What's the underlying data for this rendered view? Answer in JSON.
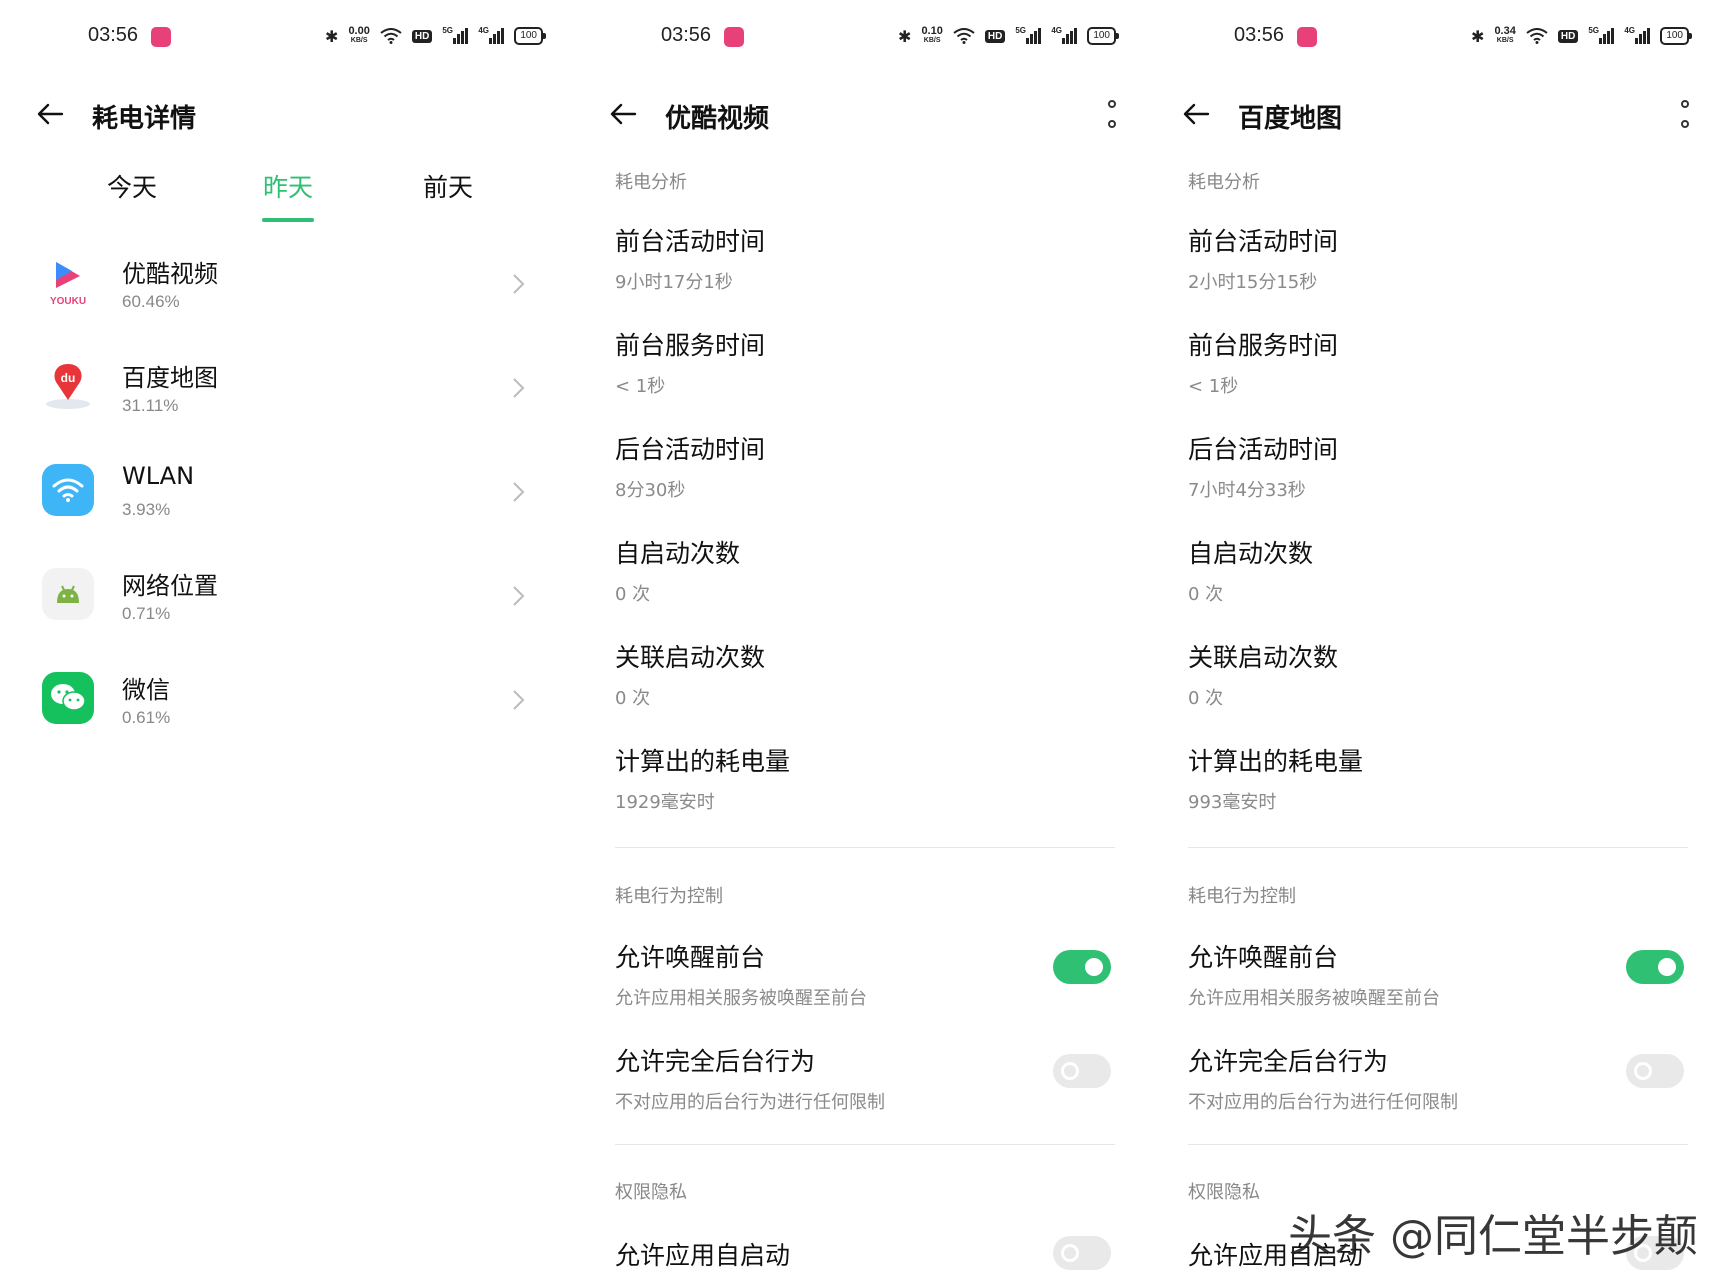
{
  "status_bar": [
    {
      "time": "03:56",
      "speed_value": "0.00",
      "speed_unit": "KB/S",
      "hd": "HD",
      "sig1": "5G",
      "sig2": "4G",
      "battery": "100"
    },
    {
      "time": "03:56",
      "speed_value": "0.10",
      "speed_unit": "KB/S",
      "hd": "HD",
      "sig1": "5G",
      "sig2": "4G",
      "battery": "100"
    },
    {
      "time": "03:56",
      "speed_value": "0.34",
      "speed_unit": "KB/S",
      "hd": "HD",
      "sig1": "5G",
      "sig2": "4G",
      "battery": "100"
    }
  ],
  "panel1": {
    "title": "耗电详情",
    "tabs": [
      "今天",
      "昨天",
      "前天"
    ],
    "active_tab": 1,
    "apps": [
      {
        "name": "优酷视频",
        "percent": "60.46%",
        "icon": "youku-icon"
      },
      {
        "name": "百度地图",
        "percent": "31.11%",
        "icon": "baidu-map-icon"
      },
      {
        "name": "WLAN",
        "percent": "3.93%",
        "icon": "wifi-icon"
      },
      {
        "name": "网络位置",
        "percent": "0.71%",
        "icon": "android-icon"
      },
      {
        "name": "微信",
        "percent": "0.61%",
        "icon": "wechat-icon"
      }
    ]
  },
  "panel2": {
    "title": "优酷视频",
    "section1": "耗电分析",
    "stats": [
      {
        "label": "前台活动时间",
        "value": "9小时17分1秒"
      },
      {
        "label": "前台服务时间",
        "value": "< 1秒"
      },
      {
        "label": "后台活动时间",
        "value": "8分30秒"
      },
      {
        "label": "自启动次数",
        "value": "0 次"
      },
      {
        "label": "关联启动次数",
        "value": "0 次"
      },
      {
        "label": "计算出的耗电量",
        "value": "1929毫安时"
      }
    ],
    "section2": "耗电行为控制",
    "controls": [
      {
        "label": "允许唤醒前台",
        "desc": "允许应用相关服务被唤醒至前台",
        "on": true
      },
      {
        "label": "允许完全后台行为",
        "desc": "不对应用的后台行为进行任何限制",
        "on": false
      }
    ],
    "section3": "权限隐私",
    "privacy": [
      {
        "label": "允许应用自启动",
        "on": false
      }
    ]
  },
  "panel3": {
    "title": "百度地图",
    "section1": "耗电分析",
    "stats": [
      {
        "label": "前台活动时间",
        "value": "2小时15分15秒"
      },
      {
        "label": "前台服务时间",
        "value": "< 1秒"
      },
      {
        "label": "后台活动时间",
        "value": "7小时4分33秒"
      },
      {
        "label": "自启动次数",
        "value": "0 次"
      },
      {
        "label": "关联启动次数",
        "value": "0 次"
      },
      {
        "label": "计算出的耗电量",
        "value": "993毫安时"
      }
    ],
    "section2": "耗电行为控制",
    "controls": [
      {
        "label": "允许唤醒前台",
        "desc": "允许应用相关服务被唤醒至前台",
        "on": true
      },
      {
        "label": "允许完全后台行为",
        "desc": "不对应用的后台行为进行任何限制",
        "on": false
      }
    ],
    "section3": "权限隐私",
    "privacy": [
      {
        "label": "允许应用自启动",
        "on": false
      }
    ]
  },
  "watermark": "头条 @同仁堂半步颠",
  "colors": {
    "accent": "#2fc073",
    "toggle_off": "#e9e9e9",
    "secondary_text": "#888888"
  }
}
